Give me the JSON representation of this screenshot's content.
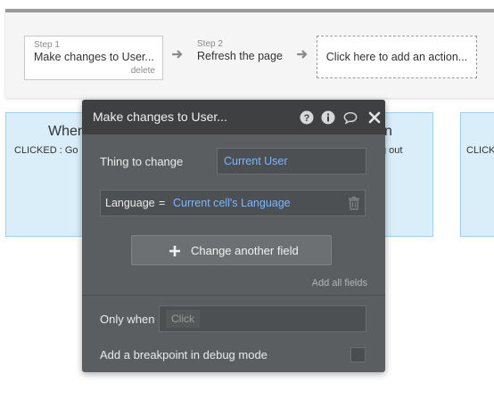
{
  "workflow": {
    "step1": {
      "label": "Step 1",
      "title": "Make changes to User...",
      "delete_label": "delete"
    },
    "step2": {
      "label": "Step 2",
      "title": "Refresh the page"
    },
    "add_action_label": "Click here to add an action..."
  },
  "background": {
    "event_a": {
      "heading": "When",
      "heading_right": "n",
      "sub": "CLICKED : Go",
      "sub_right": "g out"
    },
    "event_b": {
      "sub": "CLICK"
    }
  },
  "popup": {
    "title": "Make changes to User...",
    "icons": [
      "help-icon",
      "info-icon",
      "comment-icon",
      "close-icon"
    ],
    "thing_to_change": {
      "label": "Thing to change",
      "value": "Current User"
    },
    "field_row": {
      "field": "Language",
      "operator": "=",
      "value": "Current cell's Language"
    },
    "change_another_field_label": "Change another field",
    "add_all_fields_label": "Add all fields",
    "only_when": {
      "label": "Only when",
      "placeholder": "Click"
    },
    "breakpoint": {
      "label": "Add a breakpoint in debug mode",
      "checked": false
    }
  },
  "colors": {
    "popup_bg": "#5b5e60",
    "popup_header": "#3e4042",
    "dynamic_value": "#79b6ff",
    "event_bg": "#d9eef9"
  }
}
